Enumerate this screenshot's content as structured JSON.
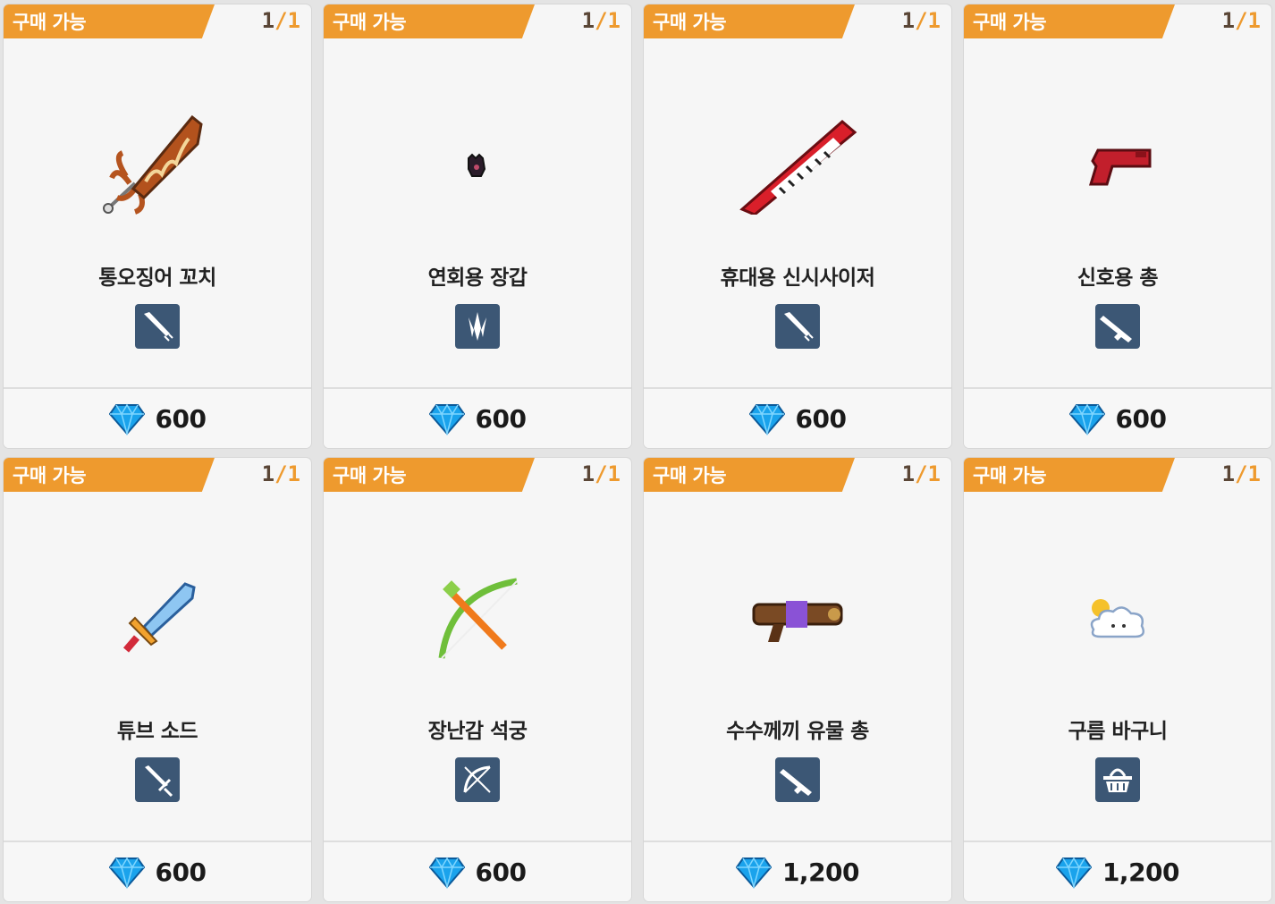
{
  "colors": {
    "ribbon": "#ee9a2e",
    "stock_current": "#5a4636",
    "type_badge": "#3c5775",
    "gem": "#1aa3ec"
  },
  "items": [
    {
      "status": "구매 가능",
      "stock_current": "1",
      "stock_sep": "/",
      "stock_max": "1",
      "name": "통오징어 꼬치",
      "icon": "squid-skewer-icon",
      "type_icon": "melee-sword-type-icon",
      "currency_icon": "gem-icon",
      "price": "600"
    },
    {
      "status": "구매 가능",
      "stock_current": "1",
      "stock_sep": "/",
      "stock_max": "1",
      "name": "연회용 장갑",
      "icon": "party-glove-icon",
      "type_icon": "claw-type-icon",
      "currency_icon": "gem-icon",
      "price": "600"
    },
    {
      "status": "구매 가능",
      "stock_current": "1",
      "stock_sep": "/",
      "stock_max": "1",
      "name": "휴대용 신시사이저",
      "icon": "keytar-icon",
      "type_icon": "melee-sword-type-icon",
      "currency_icon": "gem-icon",
      "price": "600"
    },
    {
      "status": "구매 가능",
      "stock_current": "1",
      "stock_sep": "/",
      "stock_max": "1",
      "name": "신호용 총",
      "icon": "flare-gun-icon",
      "type_icon": "rifle-type-icon",
      "currency_icon": "gem-icon",
      "price": "600"
    },
    {
      "status": "구매 가능",
      "stock_current": "1",
      "stock_sep": "/",
      "stock_max": "1",
      "name": "튜브 소드",
      "icon": "tube-sword-icon",
      "type_icon": "sword-type-icon",
      "currency_icon": "gem-icon",
      "price": "600"
    },
    {
      "status": "구매 가능",
      "stock_current": "1",
      "stock_sep": "/",
      "stock_max": "1",
      "name": "장난감 석궁",
      "icon": "toy-crossbow-icon",
      "type_icon": "bow-type-icon",
      "currency_icon": "gem-icon",
      "price": "600"
    },
    {
      "status": "구매 가능",
      "stock_current": "1",
      "stock_sep": "/",
      "stock_max": "1",
      "name": "수수께끼 유물 총",
      "icon": "relic-gun-icon",
      "type_icon": "rifle-type-icon",
      "currency_icon": "gem-icon",
      "price": "1,200"
    },
    {
      "status": "구매 가능",
      "stock_current": "1",
      "stock_sep": "/",
      "stock_max": "1",
      "name": "구름 바구니",
      "icon": "cloud-basket-icon",
      "type_icon": "basket-type-icon",
      "currency_icon": "gem-icon",
      "price": "1,200"
    }
  ]
}
